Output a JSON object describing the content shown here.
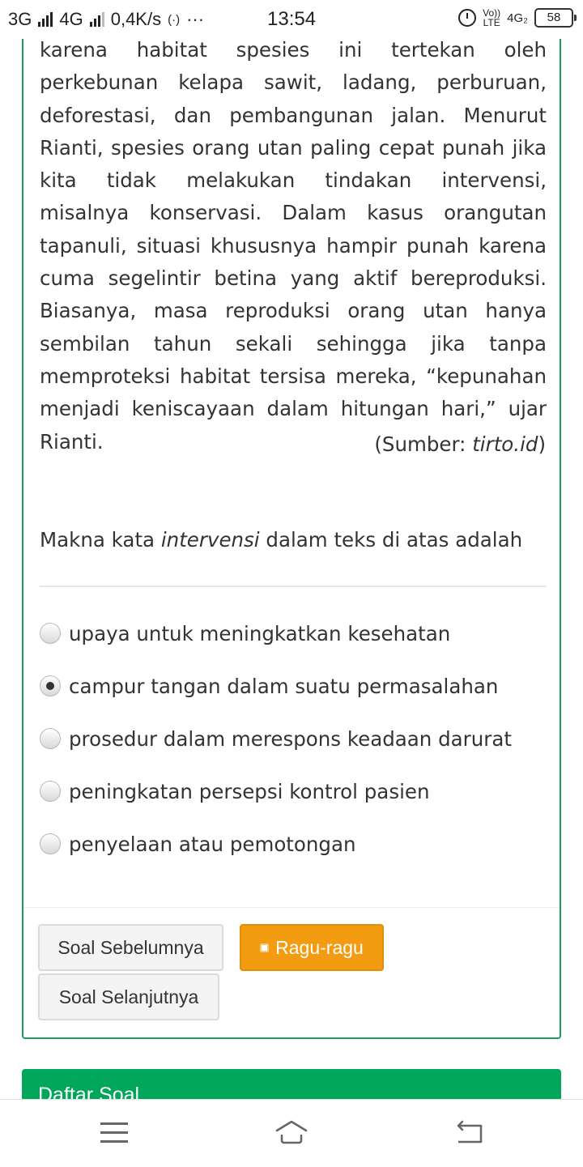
{
  "status_bar": {
    "network_1": "3G",
    "network_2": "4G",
    "speed": "0,4K/s",
    "hotspot_icon": "hotspot-icon",
    "more": "···",
    "time": "13:54",
    "volte_top": "Vo))",
    "volte_bottom": "LTE",
    "net_right": "4G₂",
    "battery": "58"
  },
  "passage": {
    "text": "karena habitat spesies ini tertekan oleh perkebunan kelapa sawit, ladang, perburuan, deforestasi, dan pembangunan jalan. Menurut Rianti, spesies orang utan paling cepat punah jika kita tidak melakukan tindakan intervensi, misalnya konservasi. Dalam kasus orangutan tapanuli, situasi khususnya hampir punah karena cuma segelintir betina yang aktif bereproduksi. Biasanya, masa reproduksi orang utan hanya sembilan tahun sekali sehingga jika tanpa memproteksi habitat tersisa mereka, “kepunahan menjadi keniscayaan dalam hitungan hari,” ujar Rianti.",
    "source_prefix": "(Sumber: ",
    "source_name": "tirto.id",
    "source_suffix": ")"
  },
  "question": {
    "before": "Makna kata ",
    "term": "intervensi",
    "after": " dalam teks di atas adalah"
  },
  "options": [
    {
      "label": "upaya untuk meningkatkan kesehatan",
      "selected": false
    },
    {
      "label": "campur tangan dalam suatu permasalahan",
      "selected": true
    },
    {
      "label": "prosedur dalam merespons keadaan darurat",
      "selected": false
    },
    {
      "label": "peningkatan persepsi kontrol pasien",
      "selected": false
    },
    {
      "label": "penyelaan atau pemotongan",
      "selected": false
    }
  ],
  "buttons": {
    "prev": "Soal Sebelumnya",
    "doubt": "Ragu-ragu",
    "next": "Soal Selanjutnya"
  },
  "panel2": {
    "title": "Daftar Soal"
  },
  "colors": {
    "card_border": "#1a9e59",
    "panel_green": "#00a65a",
    "warning": "#f39c12"
  }
}
